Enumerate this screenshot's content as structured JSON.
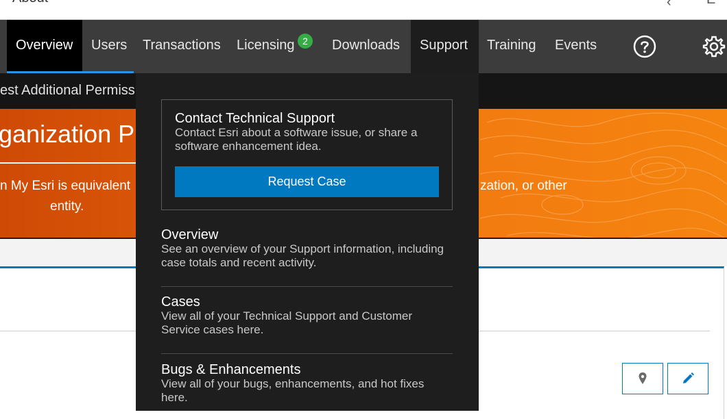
{
  "topbar": {
    "about": "About",
    "lang": "E"
  },
  "nav": {
    "items": [
      {
        "label": "Overview"
      },
      {
        "label": "Users"
      },
      {
        "label": "Transactions"
      },
      {
        "label": "Licensing",
        "badge": "2"
      },
      {
        "label": "Downloads"
      },
      {
        "label": "Support"
      },
      {
        "label": "Training"
      },
      {
        "label": "Events"
      }
    ],
    "help_icon": "question-circle-icon",
    "settings_icon": "gear-icon"
  },
  "subnav": {
    "permissions_link": "est Additional Permiss"
  },
  "banner": {
    "title": "ganization Pro",
    "desc_left_1": "n My Esri is equivalent",
    "desc_left_2": "entity.",
    "desc_right": "zation, or other"
  },
  "support_menu": {
    "contact": {
      "title": "Contact Technical Support",
      "description": "Contact Esri about a software issue, or share a software enhancement idea.",
      "button_label": "Request Case"
    },
    "entries": [
      {
        "title": "Overview",
        "description": "See an overview of your Support information, including case totals and recent activity."
      },
      {
        "title": "Cases",
        "description": "View all of your Technical Support and Customer Service cases here."
      },
      {
        "title": "Bugs & Enhancements",
        "description": "View all of your bugs, enhancements, and hot fixes here."
      }
    ]
  },
  "card": {
    "actions": [
      {
        "icon": "location-pin-icon"
      },
      {
        "icon": "pencil-icon"
      }
    ]
  },
  "colors": {
    "accent_blue": "#0079c1",
    "badge_green": "#35ac46",
    "nav_bg": "#3c3c3c",
    "dropdown_bg": "#1e1e1e",
    "banner_orange": "#f27a10"
  }
}
